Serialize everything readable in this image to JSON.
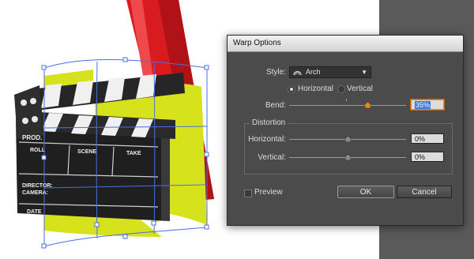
{
  "dialog": {
    "title": "Warp Options",
    "style_label": "Style:",
    "style_value": "Arch",
    "orientation": {
      "horizontal_label": "Horizontal",
      "vertical_label": "Vertical",
      "selected": "horizontal"
    },
    "bend": {
      "label": "Bend:",
      "value": "35%",
      "level": 0.35
    },
    "distortion": {
      "title": "Distortion",
      "horizontal": {
        "label": "Horizontal:",
        "value": "0%",
        "level": 0
      },
      "vertical": {
        "label": "Vertical:",
        "value": "0%",
        "level": 0
      }
    },
    "preview_label": "Preview",
    "preview_checked": false,
    "ok_label": "OK",
    "cancel_label": "Cancel"
  },
  "artwork": {
    "clapperboard": {
      "prod_label": "PROD.",
      "roll_label": "ROLL",
      "scene_label": "SCENE",
      "take_label": "TAKE",
      "director_label": "DIRECTOR:",
      "camera_label": "CAMERA:",
      "date_label": "DATE"
    }
  },
  "colors": {
    "cone_red": "#d91a1f",
    "ribbon_yellow": "#d6e21c",
    "selection_blue": "#4a6fe0",
    "dialog_bg": "#4b4b4b",
    "field_focus": "#e08a2a",
    "text_selection": "#3a78d8"
  }
}
